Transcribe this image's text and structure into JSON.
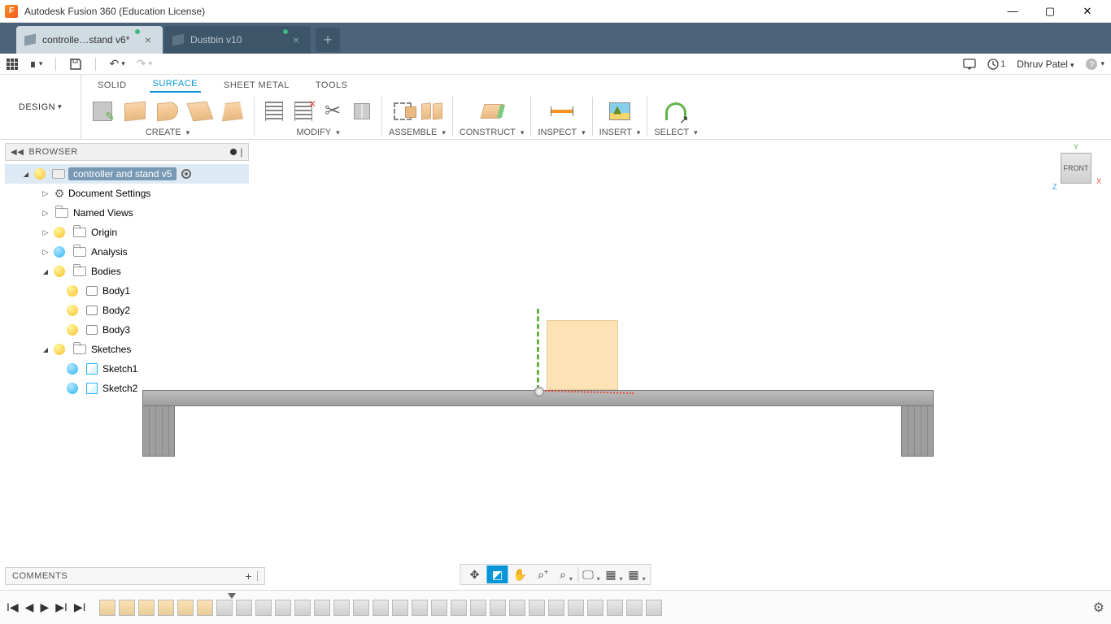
{
  "app": {
    "title": "Autodesk Fusion 360 (Education License)",
    "user": "Dhruv Patel",
    "job_count": "1"
  },
  "tabs": [
    {
      "label": "controlle…stand v6*",
      "active": true,
      "dirty": true
    },
    {
      "label": "Dustbin v10",
      "active": false,
      "dirty": true
    }
  ],
  "workspace": "DESIGN",
  "ribbon_tabs": {
    "solid": "SOLID",
    "surface": "SURFACE",
    "sheetmetal": "SHEET METAL",
    "tools": "TOOLS",
    "active": "surface"
  },
  "tool_groups": {
    "create": "CREATE",
    "modify": "MODIFY",
    "assemble": "ASSEMBLE",
    "construct": "CONSTRUCT",
    "inspect": "INSPECT",
    "insert": "INSERT",
    "select": "SELECT"
  },
  "browser": {
    "title": "BROWSER",
    "root": "controller and stand v5",
    "doc_settings": "Document Settings",
    "named_views": "Named Views",
    "origin": "Origin",
    "analysis": "Analysis",
    "bodies": "Bodies",
    "body1": "Body1",
    "body2": "Body2",
    "body3": "Body3",
    "sketches": "Sketches",
    "sketch1": "Sketch1",
    "sketch2": "Sketch2"
  },
  "viewcube": {
    "face": "FRONT",
    "y": "Y",
    "x": "X",
    "z": "Z"
  },
  "comments": "COMMENTS"
}
